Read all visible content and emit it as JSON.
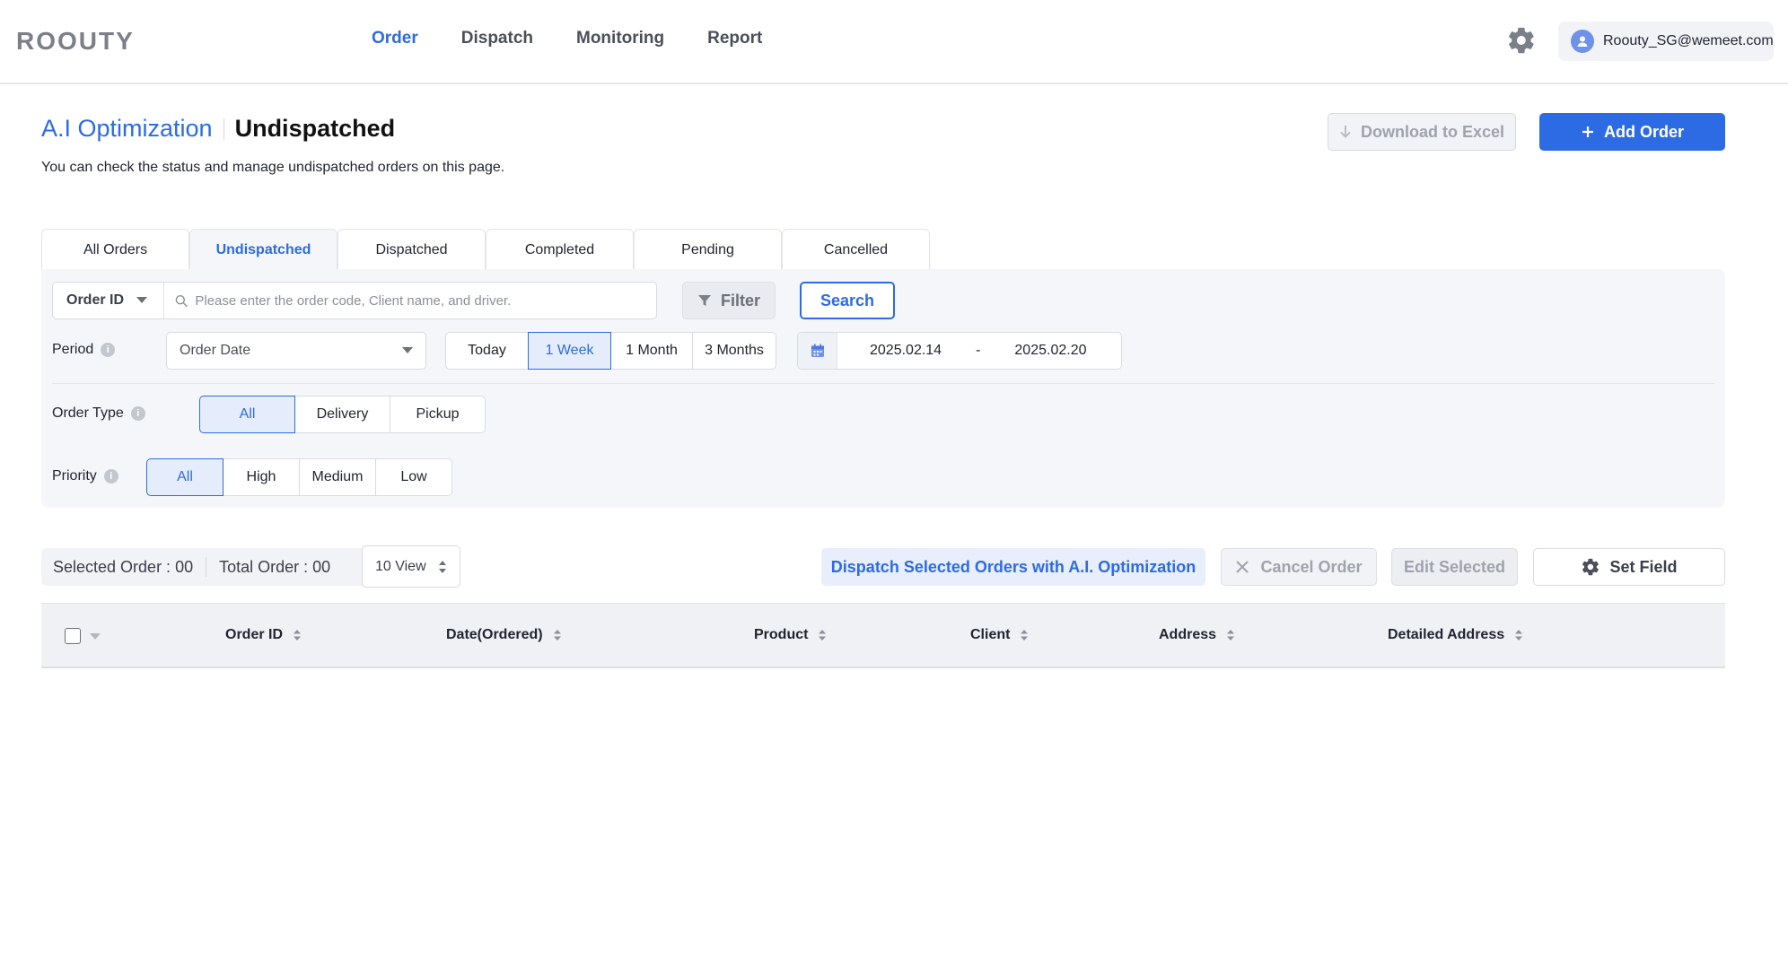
{
  "brand": {
    "logo": "ROOUTY"
  },
  "nav": {
    "items": [
      "Order",
      "Dispatch",
      "Monitoring",
      "Report"
    ],
    "active": "Order"
  },
  "user": {
    "email": "Roouty_SG@wemeet.com"
  },
  "header": {
    "breadcrumb": "A.I Optimization",
    "title": "Undispatched",
    "subtitle": "You can check the status and manage undispatched orders on this page.",
    "download_label": "Download to Excel",
    "add_label": "Add Order"
  },
  "tabs": {
    "items": [
      "All Orders",
      "Undispatched",
      "Dispatched",
      "Completed",
      "Pending",
      "Cancelled"
    ],
    "active": "Undispatched"
  },
  "filters": {
    "search_type": "Order ID",
    "search_placeholder": "Please enter the order code, Client name, and driver.",
    "filter_label": "Filter",
    "search_label": "Search",
    "period_label": "Period",
    "period_type": "Order Date",
    "period_options": [
      "Today",
      "1 Week",
      "1 Month",
      "3 Months"
    ],
    "period_active": "1 Week",
    "date_start": "2025.02.14",
    "date_sep": "-",
    "date_end": "2025.02.20",
    "order_type_label": "Order Type",
    "order_type_options": [
      "All",
      "Delivery",
      "Pickup"
    ],
    "order_type_active": "All",
    "priority_label": "Priority",
    "priority_options": [
      "All",
      "High",
      "Medium",
      "Low"
    ],
    "priority_active": "All"
  },
  "toolbar": {
    "selected_label": "Selected Order : 00",
    "total_label": "Total Order : 00",
    "view_select": "10 View",
    "dispatch_ai_label": "Dispatch Selected Orders with A.I. Optimization",
    "cancel_label": "Cancel Order",
    "edit_label": "Edit Selected",
    "setfield_label": "Set Field"
  },
  "table": {
    "columns": [
      "Order ID",
      "Date(Ordered)",
      "Product",
      "Client",
      "Address",
      "Detailed Address"
    ]
  },
  "colors": {
    "accent": "#2d6be4",
    "panel": "#f5f6f9"
  }
}
